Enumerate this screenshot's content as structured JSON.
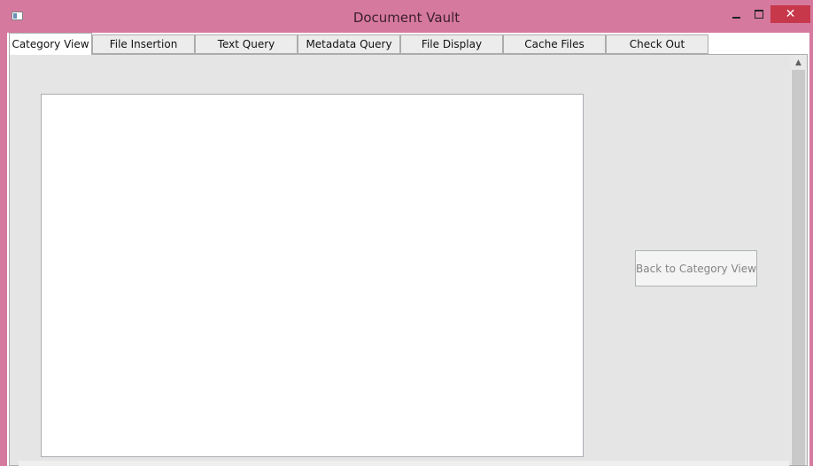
{
  "window": {
    "title": "Document Vault",
    "controls": {
      "minimize_icon": "minimize-icon",
      "maximize_icon": "maximize-icon",
      "close_label": "✕"
    }
  },
  "tabs": [
    {
      "label": "Category View",
      "active": true
    },
    {
      "label": "File Insertion",
      "active": false
    },
    {
      "label": "Text Query",
      "active": false
    },
    {
      "label": "Metadata Query",
      "active": false
    },
    {
      "label": "File Display",
      "active": false
    },
    {
      "label": "Cache Files",
      "active": false
    },
    {
      "label": "Check Out",
      "active": false
    }
  ],
  "panel": {
    "back_button_label": "Back to Category View",
    "back_button_enabled": false
  },
  "colors": {
    "titlebar": "#d6799f",
    "close_button": "#c7384a",
    "panel_background": "#e5e5e5"
  }
}
